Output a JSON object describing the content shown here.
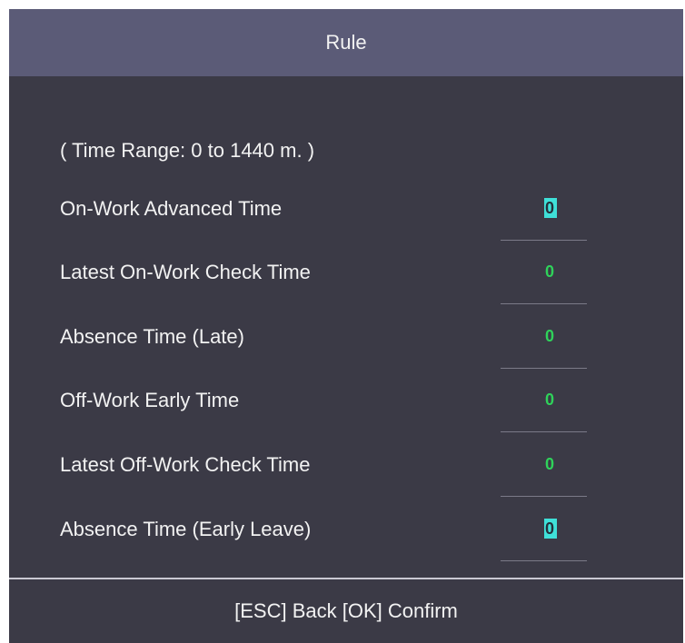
{
  "title": "Rule",
  "hint": "( Time Range: 0 to 1440 m. )",
  "rows": [
    {
      "label": "On-Work Advanced Time",
      "value": "0",
      "selected": true
    },
    {
      "label": "Latest On-Work Check Time",
      "value": "0",
      "selected": false
    },
    {
      "label": "Absence Time (Late)",
      "value": "0",
      "selected": false
    },
    {
      "label": "Off-Work Early Time",
      "value": "0",
      "selected": false
    },
    {
      "label": "Latest Off-Work Check Time",
      "value": "0",
      "selected": false
    },
    {
      "label": "Absence Time (Early Leave)",
      "value": "0",
      "selected": true
    }
  ],
  "footer": "[ESC] Back [OK] Confirm",
  "colors": {
    "title_bar": "#5b5b77",
    "background": "#3b3a46",
    "value_text": "#2fd25a",
    "selected_value_bg": "#3fe0d8"
  }
}
